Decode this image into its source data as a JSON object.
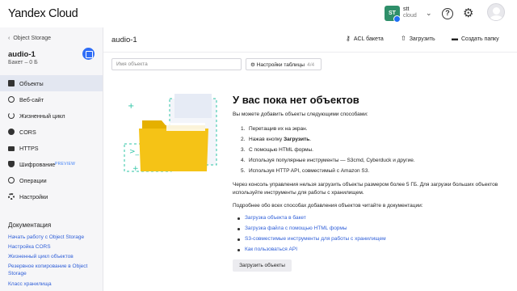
{
  "header": {
    "logo": "Yandex Cloud",
    "account_initials": "ST",
    "account_name": "stt",
    "account_sub": "cloud"
  },
  "sidebar": {
    "back_label": "Object Storage",
    "bucket_name": "audio-1",
    "bucket_sub": "Бакет – 0 Б",
    "items": [
      {
        "label": "Объекты",
        "active": true,
        "icon": "folder-icon"
      },
      {
        "label": "Веб-сайт",
        "icon": "globe-icon"
      },
      {
        "label": "Жизненный цикл",
        "icon": "lifecycle-icon"
      },
      {
        "label": "CORS",
        "icon": "cors-icon"
      },
      {
        "label": "HTTPS",
        "icon": "lock-icon"
      },
      {
        "label": "Шифрование",
        "badge": "PREVIEW",
        "icon": "shield-icon"
      },
      {
        "label": "Операции",
        "icon": "operations-icon"
      },
      {
        "label": "Настройки",
        "icon": "gear-icon"
      }
    ],
    "docs_title": "Документация",
    "docs_links": [
      "Начать работу с Object Storage",
      "Настройка CORS",
      "Жизненный цикл объектов",
      "Резервное копирование в Object Storage",
      "Класс хранилища"
    ]
  },
  "main": {
    "title": "audio-1",
    "toolbar": {
      "acl_label": "ACL бакета",
      "upload_label": "Загрузить",
      "create_folder_label": "Создать папку"
    },
    "search_placeholder": "Имя объекта",
    "table_settings_label": "Настройки таблицы",
    "table_settings_count": "4/4",
    "empty": {
      "title": "У вас пока нет объектов",
      "lead": "Вы можете добавить объекты следующими способами:",
      "steps": [
        {
          "n": "1.",
          "text": "Перетащив их на экран."
        },
        {
          "n": "2.",
          "text": "Нажав кнопку ",
          "bold": "Загрузить",
          "after": "."
        },
        {
          "n": "3.",
          "text": "С помощью HTML формы."
        },
        {
          "n": "4.",
          "text": "Используя популярные инструменты — S3cmd, Cyberduck и другие."
        },
        {
          "n": "5.",
          "text": "Используя HTTP API, совместимый с Amazon S3."
        }
      ],
      "limit_note": "Через консоль управления нельзя загрузить объекты размером более 5 ГБ. Для загрузки больших объектов используйте инструменты для работы с хранилищем.",
      "docs_note": "Подробнее обо всех способах добавления объектов читайте в документации:",
      "links": [
        "Загрузка объекта в бакет",
        "Загрузка файла с помощью HTML формы",
        "S3-совместимые инструменты для работы с хранилищем",
        "Как пользоваться API"
      ],
      "upload_button": "Загрузить объекты"
    }
  },
  "colors": {
    "accent": "#2f6df6",
    "link": "#2f5fd8",
    "folder": "#f5c316",
    "teal": "#2ec4a6"
  }
}
